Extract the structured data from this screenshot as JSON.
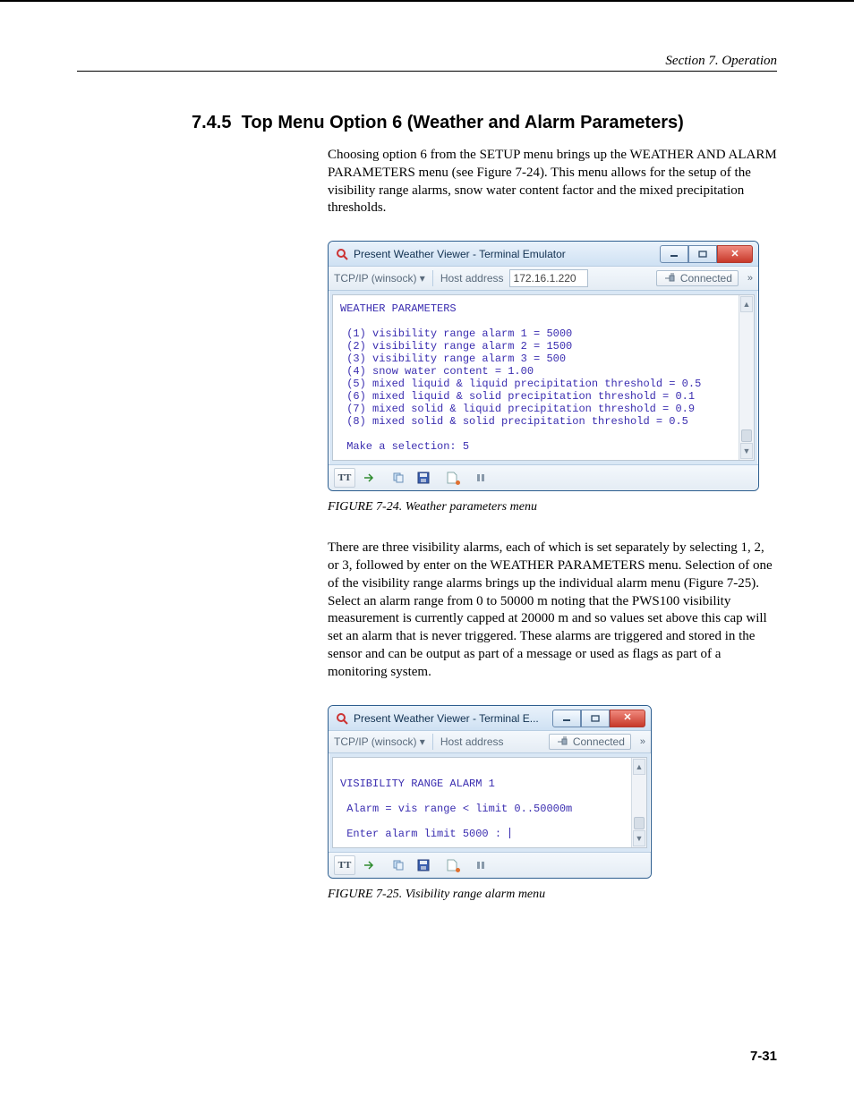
{
  "header": {
    "section_label": "Section 7.  Operation"
  },
  "section": {
    "number": "7.4.5",
    "title": "Top Menu Option 6 (Weather and Alarm Parameters)",
    "intro": "Choosing option 6 from the SETUP menu brings up the WEATHER AND ALARM PARAMETERS menu (see Figure 7-24). This menu allows for the setup of the visibility range alarms, snow water content factor and the mixed precipitation thresholds.",
    "middle": "There are three visibility alarms, each of which is set separately by selecting 1, 2, or 3, followed by enter on the WEATHER PARAMETERS menu. Selection of one of the visibility range alarms brings up the individual alarm menu (Figure 7-25). Select an alarm range from 0 to 50000 m noting that the PWS100 visibility measurement is currently capped at 20000 m and so values set above this cap will set an alarm that is never triggered. These alarms are triggered and stored in the sensor and can be output as part of a message or used as flags as part of a monitoring system."
  },
  "figures": {
    "f1": {
      "caption": "FIGURE 7-24.  Weather parameters menu"
    },
    "f2": {
      "caption": "FIGURE 7-25.  Visibility range alarm menu"
    }
  },
  "win_common": {
    "protocol": "TCP/IP (winsock)",
    "host_label": "Host address",
    "connected": "Connected",
    "tt_label": "TT"
  },
  "win1": {
    "title": "Present Weather Viewer - Terminal Emulator",
    "ip": "172.16.1.220",
    "menu_title": "WEATHER PARAMETERS",
    "items": [
      " (1) visibility range alarm 1 = 5000",
      " (2) visibility range alarm 2 = 1500",
      " (3) visibility range alarm 3 = 500",
      " (4) snow water content = 1.00",
      " (5) mixed liquid & liquid precipitation threshold = 0.5",
      " (6) mixed liquid & solid precipitation threshold = 0.1",
      " (7) mixed solid & liquid precipitation threshold = 0.9",
      " (8) mixed solid & solid precipitation threshold = 0.5"
    ],
    "prompt": " Make a selection: 5"
  },
  "win2": {
    "title": "Present Weather Viewer - Terminal E...",
    "menu_title": "VISIBILITY RANGE ALARM 1",
    "line1": " Alarm = vis range < limit 0..50000m",
    "prompt": " Enter alarm limit 5000 : "
  },
  "page_number": "7-31",
  "chevrons": "»"
}
